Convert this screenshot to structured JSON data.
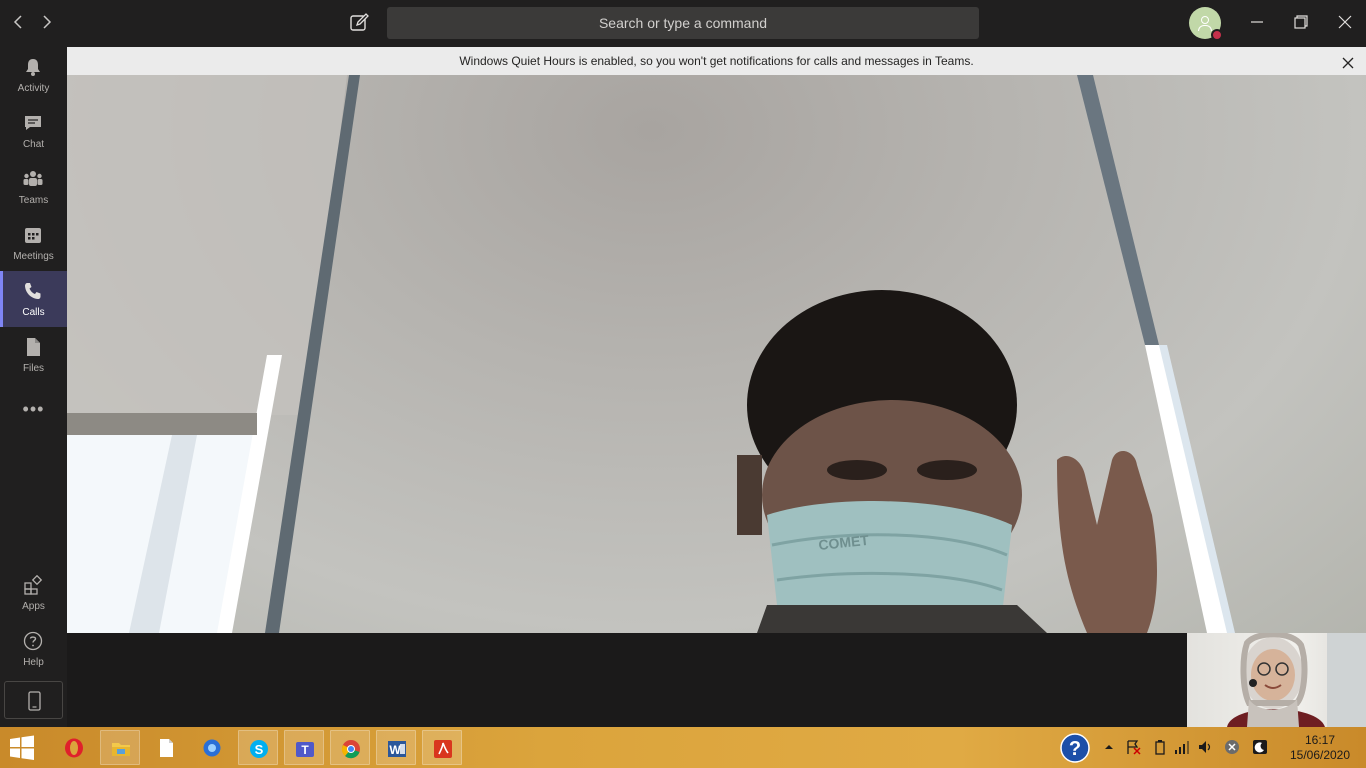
{
  "titlebar": {
    "search_placeholder": "Search or type a command",
    "back_icon": "chevron-left-icon",
    "forward_icon": "chevron-right-icon",
    "compose_icon": "compose-icon"
  },
  "rail": {
    "items": [
      {
        "label": "Activity",
        "icon": "bell-icon"
      },
      {
        "label": "Chat",
        "icon": "chat-icon"
      },
      {
        "label": "Teams",
        "icon": "teams-icon"
      },
      {
        "label": "Meetings",
        "icon": "calendar-icon"
      },
      {
        "label": "Calls",
        "icon": "phone-icon",
        "active": true
      },
      {
        "label": "Files",
        "icon": "file-icon"
      }
    ],
    "more_label": "•••",
    "bottom": [
      {
        "label": "Apps",
        "icon": "apps-icon"
      },
      {
        "label": "Help",
        "icon": "help-icon"
      }
    ]
  },
  "notice": {
    "text": "Windows Quiet Hours is enabled, so you won't get notifications for calls and messages in Teams."
  },
  "video": {
    "mask_text": "COMET"
  },
  "taskbar": {
    "time": "16:17",
    "date": "15/06/2020",
    "apps": [
      "windows-start-icon",
      "opera-icon",
      "file-explorer-icon",
      "notepad-icon",
      "browser-icon",
      "skype-icon",
      "teams-icon",
      "chrome-icon",
      "word-icon",
      "acrobat-icon"
    ]
  },
  "colors": {
    "accent": "#7f85f5",
    "rail_bg": "#201f1f",
    "status_busy": "#c4314b",
    "taskbar": "#dba43c"
  }
}
